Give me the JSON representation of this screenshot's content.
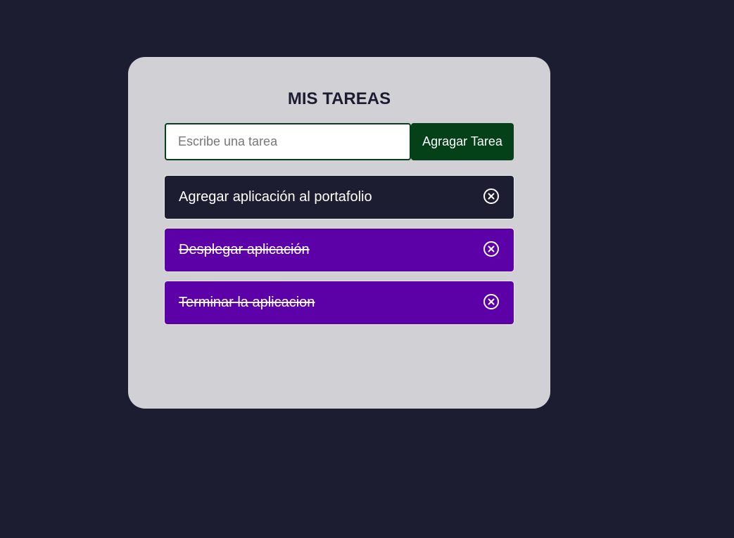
{
  "header": {
    "title": "MIS TAREAS"
  },
  "form": {
    "input_value": "",
    "input_placeholder": "Escribe una tarea",
    "add_button_label": "Agragar Tarea"
  },
  "tasks": [
    {
      "text": "Agregar aplicación al portafolio",
      "completed": false,
      "icon": "close-circle-icon"
    },
    {
      "text": "Desplegar aplicación",
      "completed": true,
      "icon": "close-circle-icon"
    },
    {
      "text": "Terminar la aplicacion",
      "completed": true,
      "icon": "close-circle-icon"
    }
  ],
  "colors": {
    "background": "#1d1d31",
    "card": "#d1d0d5",
    "accent_green": "#044119",
    "completed_purple": "#5c00a8",
    "pending_dark": "#1d1d31"
  }
}
